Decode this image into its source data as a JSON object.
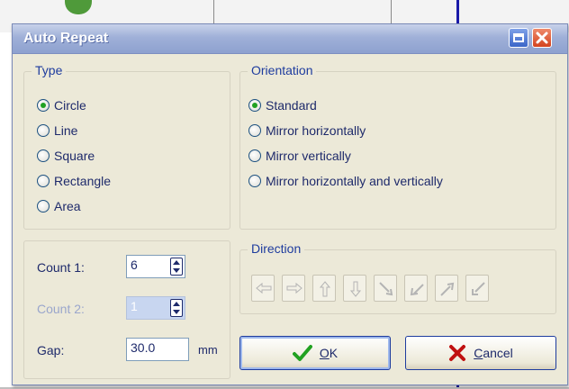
{
  "window": {
    "title": "Auto Repeat"
  },
  "type_group": {
    "title": "Type",
    "options": [
      {
        "label": "Circle",
        "checked": true
      },
      {
        "label": "Line",
        "checked": false
      },
      {
        "label": "Square",
        "checked": false
      },
      {
        "label": "Rectangle",
        "checked": false
      },
      {
        "label": "Area",
        "checked": false
      }
    ]
  },
  "orientation_group": {
    "title": "Orientation",
    "options": [
      {
        "label": "Standard",
        "checked": true
      },
      {
        "label": "Mirror horizontally",
        "checked": false
      },
      {
        "label": "Mirror vertically",
        "checked": false
      },
      {
        "label": "Mirror horizontally and vertically",
        "checked": false
      }
    ]
  },
  "fields": {
    "count1": {
      "label": "Count 1:",
      "value": "6"
    },
    "count2": {
      "label": "Count 2:",
      "value": "1"
    },
    "gap": {
      "label": "Gap:",
      "value": "30.0",
      "unit": "mm"
    }
  },
  "direction_group": {
    "title": "Direction",
    "buttons": [
      "arrow-left-icon",
      "arrow-right-icon",
      "arrow-up-icon",
      "arrow-down-icon",
      "arrow-down-right-icon",
      "arrow-up-left-icon",
      "arrow-up-right-icon",
      "arrow-down-left-icon"
    ]
  },
  "buttons": {
    "ok_prefix": "",
    "ok_key": "O",
    "ok_rest": "K",
    "cancel_key": "C",
    "cancel_rest": "ancel"
  },
  "colors": {
    "accent": "#1e3c9e",
    "check_green": "#21a121",
    "cancel_red": "#c01010"
  }
}
